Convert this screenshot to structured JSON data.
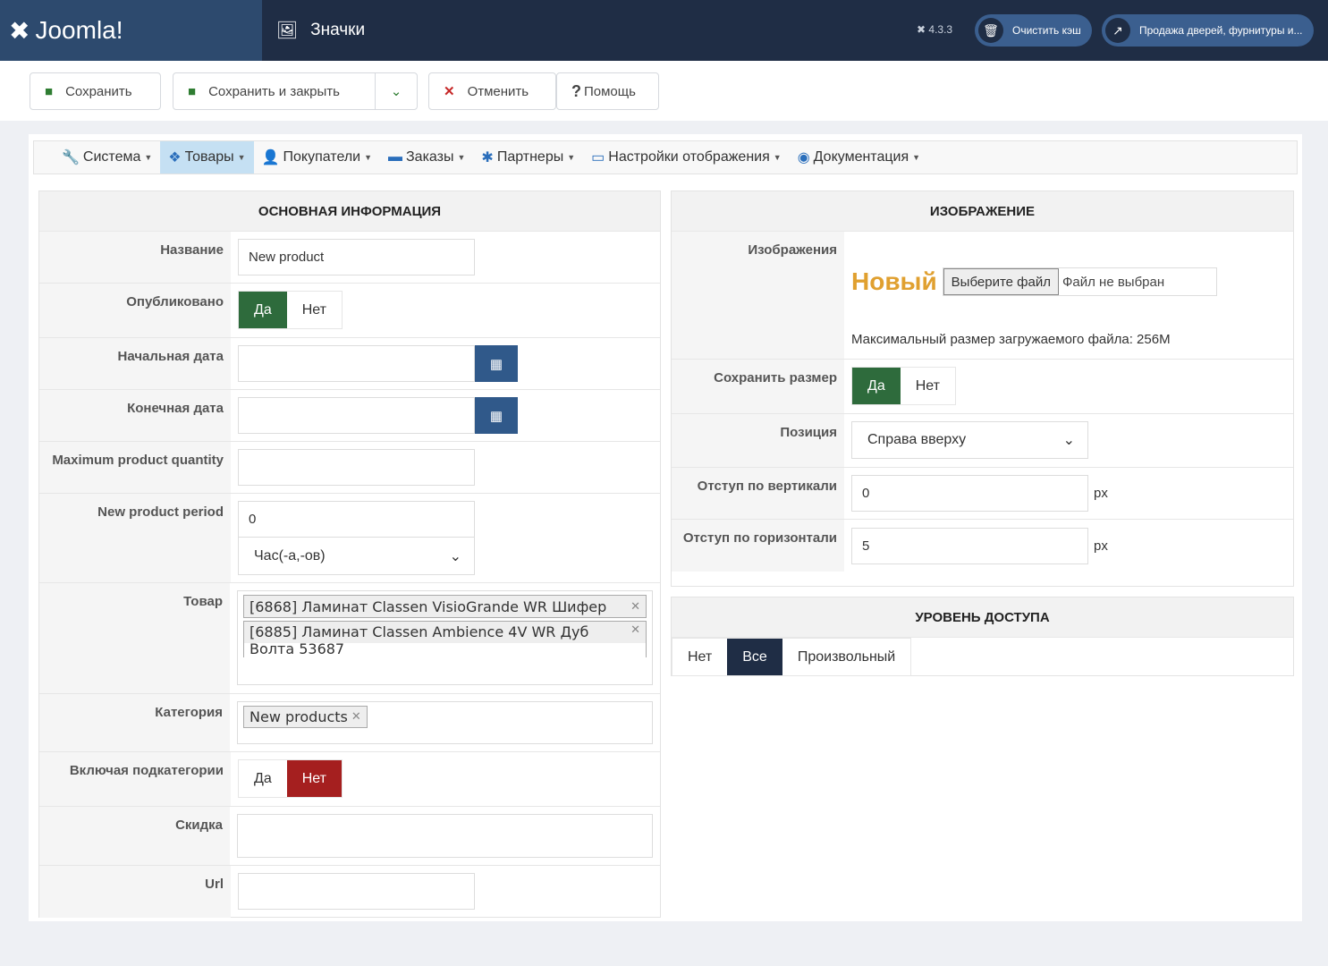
{
  "header": {
    "logo": "Joomla!",
    "title": "Значки",
    "version": "4.3.3",
    "clear_cache": "Очистить кэш",
    "site": "Продажа дверей, фурнитуры и..."
  },
  "toolbar": {
    "save": "Сохранить",
    "save_close": "Сохранить и закрыть",
    "cancel": "Отменить",
    "help": "Помощь"
  },
  "menu": [
    {
      "label": "Система",
      "icon": "wrench-icon"
    },
    {
      "label": "Товары",
      "icon": "cubes-icon",
      "active": true
    },
    {
      "label": "Покупатели",
      "icon": "user-icon"
    },
    {
      "label": "Заказы",
      "icon": "credit-card-icon"
    },
    {
      "label": "Партнеры",
      "icon": "users-cog-icon"
    },
    {
      "label": "Настройки отображения",
      "icon": "desktop-icon"
    },
    {
      "label": "Документация",
      "icon": "life-ring-icon"
    }
  ],
  "main": {
    "title": "ОСНОВНАЯ ИНФОРМАЦИЯ",
    "name_label": "Название",
    "name_value": "New product",
    "published_label": "Опубликовано",
    "yes": "Да",
    "no": "Нет",
    "start_label": "Начальная дата",
    "end_label": "Конечная дата",
    "maxq_label": "Maximum product quantity",
    "period_label": "New product period",
    "period_value": "0",
    "period_unit": "Час(-а,-ов)",
    "product_label": "Товар",
    "products": [
      "[6868] Ламинат Classen VisioGrande WR Шифер",
      "[6885] Ламинат Classen Ambience 4V WR Дуб Волта 53687"
    ],
    "category_label": "Категория",
    "category": "New products",
    "subcat_label": "Включая подкатегории",
    "discount_label": "Скидка",
    "url_label": "Url"
  },
  "image": {
    "title": "ИЗОБРАЖЕНИЕ",
    "images_label": "Изображения",
    "badge": "Новый",
    "choose": "Выберите файл",
    "no_file": "Файл не выбран",
    "max_size": "Максимальный размер загружаемого файла: 256M",
    "keep_label": "Сохранить размер",
    "position_label": "Позиция",
    "position_value": "Справа вверху",
    "vert_label": "Отступ по вертикали",
    "vert_value": "0",
    "horiz_label": "Отступ по горизонтали",
    "horiz_value": "5",
    "unit": "px"
  },
  "access": {
    "title": "УРОВЕНЬ ДОСТУПА",
    "options": [
      "Нет",
      "Все",
      "Произвольный"
    ],
    "selected": "Все"
  },
  "colors": {
    "header": "#1f2d45",
    "accent": "#30598a",
    "yes": "#2e6b3c",
    "no": "#a51f1f",
    "badge": "#e0a030"
  }
}
